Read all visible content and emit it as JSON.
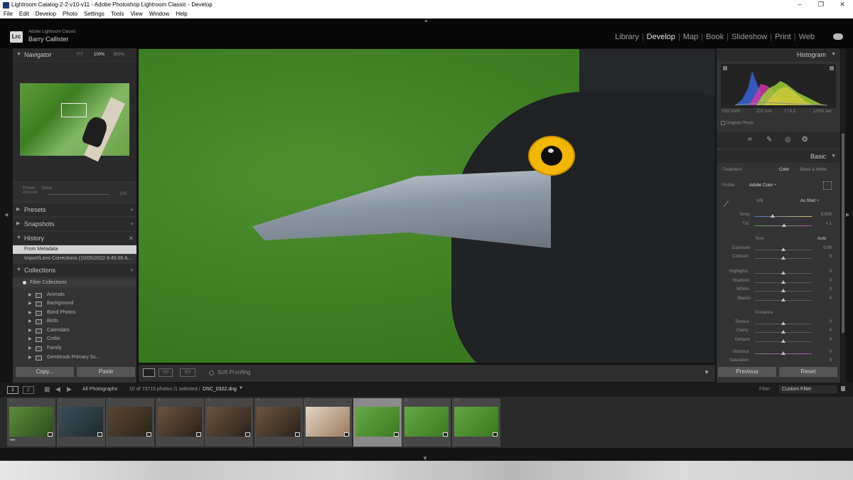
{
  "window": {
    "title": "Lightroom Catalog-2-2-v10-v11 - Adobe Photoshop Lightroom Classic - Develop",
    "controls": [
      "–",
      "❐",
      "✕"
    ]
  },
  "menubar": [
    "File",
    "Edit",
    "Develop",
    "Photo",
    "Settings",
    "Tools",
    "View",
    "Window",
    "Help"
  ],
  "identity": {
    "logo": "Lrc",
    "product": "Adobe Lightroom Classic",
    "user": "Barry Callister"
  },
  "modules": [
    {
      "label": "Library"
    },
    {
      "label": "Develop",
      "active": true
    },
    {
      "label": "Map"
    },
    {
      "label": "Book"
    },
    {
      "label": "Slideshow"
    },
    {
      "label": "Print"
    },
    {
      "label": "Web"
    }
  ],
  "left": {
    "navigator": {
      "title": "Navigator",
      "zoom": [
        "FIT",
        "100%",
        "800%"
      ]
    },
    "preset": {
      "label": "Preset",
      "value": "None",
      "amount_label": "Amount",
      "amount": "100"
    },
    "presets_title": "Presets",
    "snapshots_title": "Snapshots",
    "history_title": "History",
    "history": [
      "From Metadata",
      "Import/Lens Corrections (10/05/2022 8:45:06 A..."
    ],
    "collections_title": "Collections",
    "filter_label": "Filter Collections",
    "collections": [
      "Animals",
      "Background",
      "Band Photos",
      "Birds",
      "Calendars",
      "Crebs",
      "Family",
      "Gembrook Primary Sc..."
    ],
    "copy_label": "Copy...",
    "paste_label": "Paste"
  },
  "toolbar": {
    "view2": "Y|Y",
    "view3": "X|Y",
    "softproof": "Soft Proofing"
  },
  "right": {
    "histogram_title": "Histogram",
    "hist_meta": [
      "ISO 5000",
      "210 mm",
      "f / 6.3",
      "1/200 sec"
    ],
    "original_photo": "Original Photo",
    "basic_title": "Basic",
    "treatment": {
      "label": "Treatment",
      "color": "Color",
      "bw": "Black & White"
    },
    "profile": {
      "label": "Profile",
      "value": "Adobe Color ÷"
    },
    "wb": {
      "label": "WB",
      "value": "As Shot ÷"
    },
    "temp": {
      "label": "Temp",
      "value": "5,000"
    },
    "tint": {
      "label": "Tint",
      "value": "+ 1"
    },
    "tone_label": "Tone",
    "auto_label": "Auto",
    "tone": [
      {
        "label": "Exposure",
        "value": "0.00"
      },
      {
        "label": "Contrast",
        "value": "0"
      },
      {
        "label": "Highlights",
        "value": "0"
      },
      {
        "label": "Shadows",
        "value": "0"
      },
      {
        "label": "Whites",
        "value": "0"
      },
      {
        "label": "Blacks",
        "value": "0"
      }
    ],
    "presence_label": "Presence",
    "presence": [
      {
        "label": "Texture",
        "value": "0"
      },
      {
        "label": "Clarity",
        "value": "0"
      },
      {
        "label": "Dehaze",
        "value": "0"
      },
      {
        "label": "Vibrance",
        "value": "0"
      },
      {
        "label": "Saturation",
        "value": "0"
      }
    ],
    "previous_label": "Previous",
    "reset_label": "Reset"
  },
  "filmbar": {
    "page1": "1",
    "page2": "2",
    "source": "All Photographs",
    "count": "10 of 73715 photos /1 selected /",
    "filename": "DSC_0322.dng",
    "filter_label": "Filter :",
    "filter_value": "Custom Filter"
  },
  "thumbs": [
    {
      "num": "1",
      "c1": "#5f8b3c",
      "c2": "#2d4c1c"
    },
    {
      "num": "2",
      "c1": "#3b4f58",
      "c2": "#1f2a2f"
    },
    {
      "num": "3",
      "c1": "#5a4634",
      "c2": "#2c241b"
    },
    {
      "num": "4",
      "c1": "#6b5440",
      "c2": "#2a2119"
    },
    {
      "num": "5",
      "c1": "#6a5540",
      "c2": "#2b2219"
    },
    {
      "num": "6",
      "c1": "#6b5741",
      "c2": "#2a2119"
    },
    {
      "num": "7",
      "c1": "#e0d6c8",
      "c2": "#9e7a5c"
    },
    {
      "num": "8",
      "c1": "#67a845",
      "c2": "#3c7a22"
    },
    {
      "num": "9",
      "c1": "#66a744",
      "c2": "#3c7a22"
    },
    {
      "num": "10",
      "c1": "#64a543",
      "c2": "#3a7820"
    }
  ]
}
